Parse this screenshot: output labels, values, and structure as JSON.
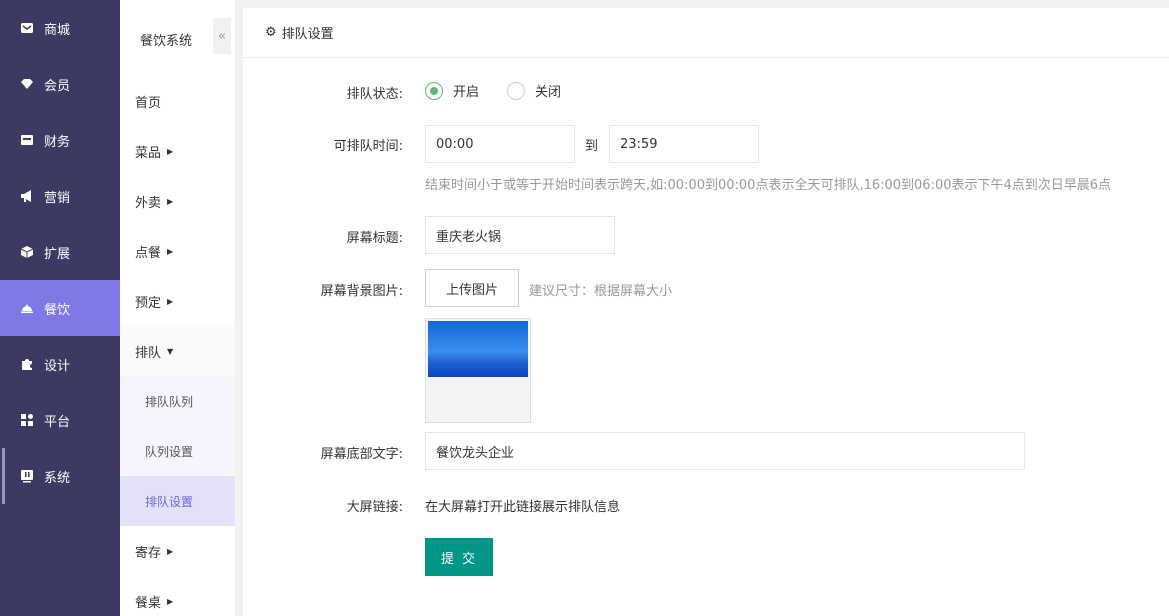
{
  "nav": [
    {
      "label": "商城",
      "icon": "mail-icon"
    },
    {
      "label": "会员",
      "icon": "tag-icon"
    },
    {
      "label": "财务",
      "icon": "wallet-icon"
    },
    {
      "label": "营销",
      "icon": "megaphone-icon"
    },
    {
      "label": "扩展",
      "icon": "cube-icon"
    },
    {
      "label": "餐饮",
      "icon": "cloche-icon",
      "active": true
    },
    {
      "label": "设计",
      "icon": "puzzle-icon"
    },
    {
      "label": "平台",
      "icon": "grid-icon"
    },
    {
      "label": "系统",
      "icon": "monitor-icon"
    }
  ],
  "submenu": {
    "title": "餐饮系统",
    "collapse_label": "«",
    "items": [
      {
        "label": "首页",
        "arrow": ""
      },
      {
        "label": "菜品",
        "arrow": "▶"
      },
      {
        "label": "外卖",
        "arrow": "▶"
      },
      {
        "label": "点餐",
        "arrow": "▶"
      },
      {
        "label": "预定",
        "arrow": "▶"
      },
      {
        "label": "排队",
        "arrow": "▼"
      }
    ],
    "children": [
      {
        "label": "排队队列"
      },
      {
        "label": "队列设置"
      },
      {
        "label": "排队设置",
        "active": true
      }
    ],
    "items_after": [
      {
        "label": "寄存",
        "arrow": "▶"
      },
      {
        "label": "餐桌",
        "arrow": "▶"
      }
    ]
  },
  "panel": {
    "title": "排队设置",
    "gear_glyph": "⚙"
  },
  "form": {
    "status_label": "排队状态:",
    "status_on": "开启",
    "status_off": "关闭",
    "time_label": "可排队时间:",
    "time_start": "00:00",
    "time_sep": "到",
    "time_end": "23:59",
    "time_hint": "结束时间小于或等于开始时间表示跨天,如:00:00到00:00点表示全天可排队,16:00到06:00表示下午4点到次日早晨6点",
    "screen_title_label": "屏幕标题:",
    "screen_title_value": "重庆老火锅",
    "bg_label": "屏幕背景图片:",
    "upload_label": "上传图片",
    "bg_hint": "建议尺寸：根据屏幕大小",
    "footer_label": "屏幕底部文字:",
    "footer_value": "餐饮龙头企业",
    "link_label": "大屏链接:",
    "link_text": "在大屏幕打开此链接展示排队信息",
    "submit_label": "提 交"
  },
  "colors": {
    "nav_bg": "#3c3a62",
    "nav_active": "#7e79e6",
    "radio_checked": "#5fb878",
    "submit_bg": "#009688"
  }
}
